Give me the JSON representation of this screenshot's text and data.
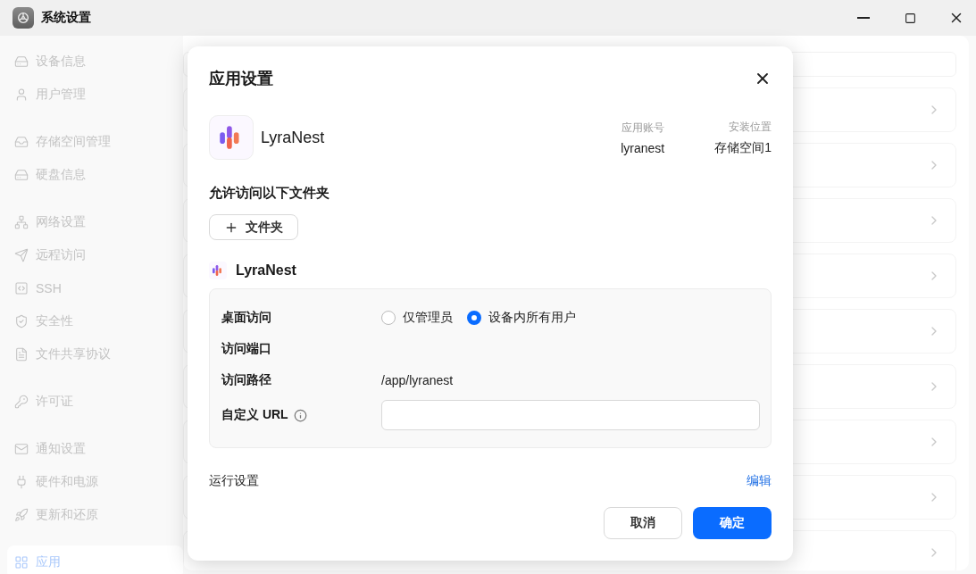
{
  "window": {
    "title": "系统设置"
  },
  "sidebar": {
    "groups": [
      {
        "items": [
          {
            "label": "设备信息",
            "selected": false
          },
          {
            "label": "用户管理",
            "selected": false
          }
        ]
      },
      {
        "items": [
          {
            "label": "存储空间管理",
            "selected": false
          },
          {
            "label": "硬盘信息",
            "selected": false
          }
        ]
      },
      {
        "items": [
          {
            "label": "网络设置",
            "selected": false
          },
          {
            "label": "远程访问",
            "selected": false
          },
          {
            "label": "SSH",
            "selected": false
          },
          {
            "label": "安全性",
            "selected": false
          },
          {
            "label": "文件共享协议",
            "selected": false
          }
        ]
      },
      {
        "items": [
          {
            "label": "许可证",
            "selected": false
          }
        ]
      },
      {
        "items": [
          {
            "label": "通知设置",
            "selected": false
          },
          {
            "label": "硬件和电源",
            "selected": false
          },
          {
            "label": "更新和还原",
            "selected": false
          }
        ]
      },
      {
        "items": [
          {
            "label": "应用",
            "selected": true
          }
        ]
      }
    ]
  },
  "dialog": {
    "title": "应用设置",
    "app": {
      "name": "LyraNest",
      "info": [
        {
          "label": "应用账号",
          "value": "lyranest"
        },
        {
          "label": "安装位置",
          "value": "存储空间1"
        }
      ]
    },
    "folders": {
      "title": "允许访问以下文件夹",
      "add_button": "文件夹"
    },
    "entry": {
      "name": "LyraNest",
      "rows": [
        {
          "kind": "radio",
          "label": "桌面访问",
          "options": [
            {
              "label": "仅管理员",
              "selected": false
            },
            {
              "label": "设备内所有用户",
              "selected": true
            }
          ]
        },
        {
          "kind": "text",
          "label": "访问端口"
        },
        {
          "kind": "text",
          "label": "访问路径",
          "value": "/app/lyranest"
        },
        {
          "kind": "input",
          "label": "自定义 URL",
          "info": true
        }
      ]
    },
    "run_settings": {
      "label": "运行设置",
      "link": "编辑"
    },
    "buttons": [
      {
        "label": "取消",
        "kind": "secondary"
      },
      {
        "label": "确定",
        "kind": "primary"
      }
    ]
  }
}
